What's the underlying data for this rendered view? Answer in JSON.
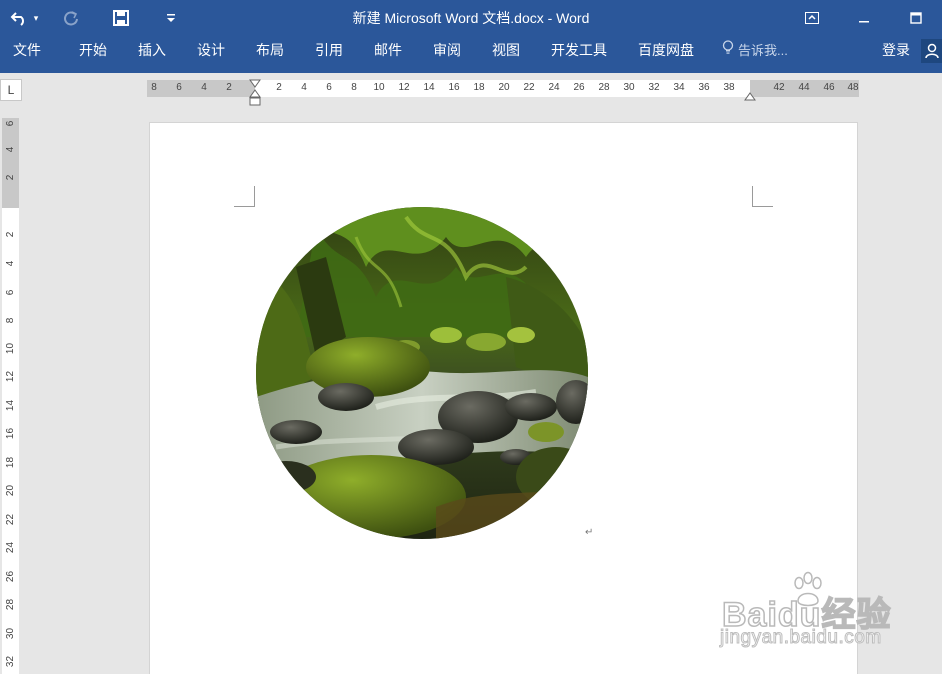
{
  "title_bar": {
    "title": "新建 Microsoft Word 文档.docx - Word",
    "undo_icon": "undo-icon",
    "redo_icon": "redo-icon",
    "save_icon": "save-icon",
    "customize_icon": "customize-qat-icon",
    "window_buttons": [
      "ribbon-display-options-icon",
      "minimize-icon",
      "maximize-icon"
    ]
  },
  "ribbon": {
    "tabs": [
      "文件",
      "开始",
      "插入",
      "设计",
      "布局",
      "引用",
      "邮件",
      "审阅",
      "视图",
      "开发工具",
      "百度网盘"
    ],
    "tell_me": "告诉我...",
    "sign_in": "登录",
    "share_icon": "share-person-icon"
  },
  "rulers": {
    "tab_selector": "L",
    "horizontal_ticks": [
      "8",
      "6",
      "4",
      "2",
      "2",
      "4",
      "6",
      "8",
      "10",
      "12",
      "14",
      "16",
      "18",
      "20",
      "22",
      "24",
      "26",
      "28",
      "30",
      "32",
      "34",
      "36",
      "38",
      "42",
      "44",
      "46",
      "48"
    ],
    "vertical_ticks_top": [
      "6",
      "4",
      "2"
    ],
    "vertical_ticks": [
      "2",
      "4",
      "6",
      "8",
      "10",
      "12",
      "14",
      "16",
      "18",
      "20",
      "22",
      "24",
      "26",
      "28",
      "30",
      "32"
    ]
  },
  "document": {
    "image_description": "forest-stream-rocks-photo",
    "paragraph_mark": "↵"
  },
  "watermark": {
    "brand": "Baidu经验",
    "url": "jingyan.baidu.com"
  },
  "colors": {
    "ribbon_blue": "#2b579a",
    "workspace_gray": "#e6e6e6",
    "page_white": "#ffffff"
  }
}
